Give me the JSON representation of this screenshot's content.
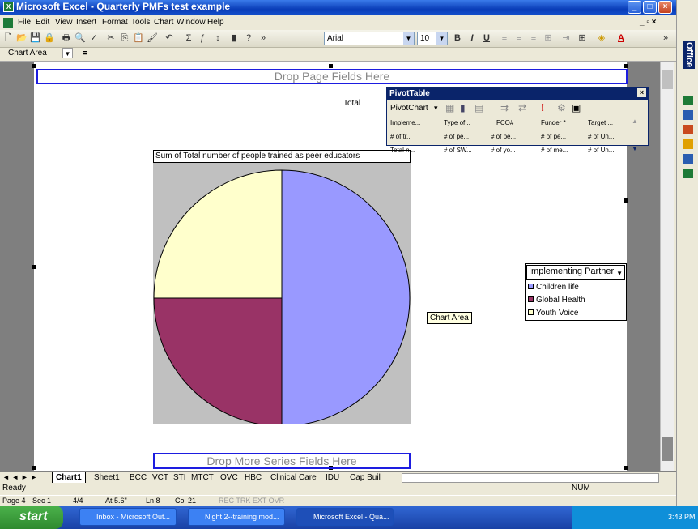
{
  "window": {
    "title": "Microsoft Excel - Quarterly PMFs test example",
    "controls": [
      "_",
      "□",
      "×"
    ]
  },
  "menu": {
    "items": [
      "File",
      "Edit",
      "View",
      "Insert",
      "Format",
      "Tools",
      "Chart",
      "Window",
      "Help"
    ],
    "doc_controls": "_ ▫ ×"
  },
  "toolbar": {
    "font_name": "Arial",
    "font_size": "10",
    "bold": "B",
    "italic": "I",
    "underline": "U"
  },
  "formula_bar": {
    "name_box": "Chart Area",
    "equals": "="
  },
  "chart": {
    "drop_page_fields": "Drop Page Fields Here",
    "drop_series_fields": "Drop More Series Fields Here",
    "total_label": "Total",
    "tooltip": "Chart Area"
  },
  "chart_data": {
    "type": "pie",
    "title": "Sum of Total number of people trained as peer educators",
    "categories": [
      "Children life",
      "Global Health",
      "Youth Voice"
    ],
    "values": [
      50,
      25,
      25
    ],
    "colors": [
      "#9999FF",
      "#993366",
      "#FFFFCC"
    ],
    "legend_title": "Implementing Partner",
    "legend_position": "right"
  },
  "pivot": {
    "title": "PivotTable",
    "close": "×",
    "menu": "PivotChart",
    "fields_row1": [
      "Impleme...",
      "Type of...",
      "FCO#",
      "Funder *",
      "Target ..."
    ],
    "fields_row2": [
      "# of tr...",
      "# of pe...",
      "# of pe...",
      "# of pe...",
      "# of Un..."
    ],
    "fields_row3": [
      "Total n...",
      "# of SW...",
      "# of yo...",
      "# of me...",
      "# of Un..."
    ]
  },
  "tabs": {
    "nav": "◄ ◄ ► ►",
    "sheets": [
      "Chart1",
      "Sheet1",
      "BCC",
      "VCT",
      "STI",
      "MTCT",
      "OVC",
      "HBC",
      "Clinical Care",
      "IDU",
      "Cap Buil"
    ]
  },
  "status": {
    "ready": "Ready",
    "num": "NUM"
  },
  "word_status": {
    "page": "Page 4",
    "sec": "Sec 1",
    "pages": "4/4",
    "at": "At 5.6\"",
    "ln": "Ln 8",
    "col": "Col 21",
    "flags": "REC  TRK  EXT  OVR"
  },
  "taskbar": {
    "start": "start",
    "tasks": [
      "Inbox - Microsoft Out...",
      "Night 2--training mod...",
      "Microsoft Excel - Qua..."
    ],
    "clock": "3:43 PM"
  },
  "office_bar": {
    "label": "Office"
  }
}
